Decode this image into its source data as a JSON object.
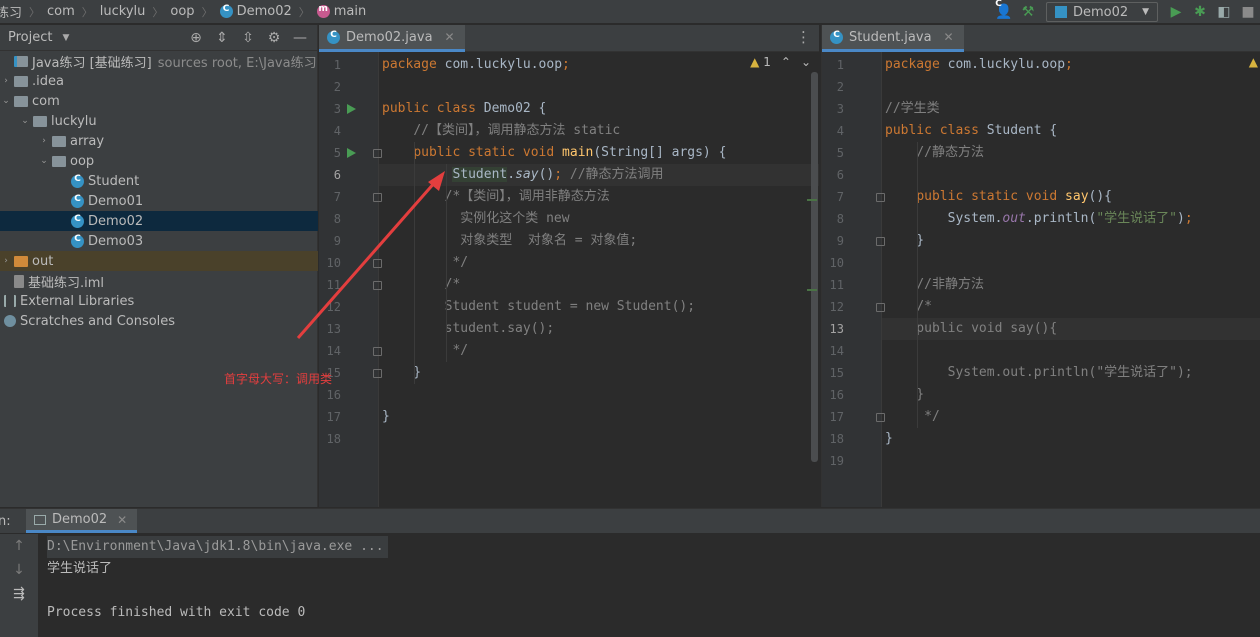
{
  "breadcrumbs": [
    "练习",
    "com",
    "luckylu",
    "oop",
    "Demo02",
    "main"
  ],
  "toolbar": {
    "run_config": "Demo02"
  },
  "project_panel": {
    "title": "Project",
    "tree": [
      {
        "label": "Java练习 [基础练习]",
        "hint": "sources root,  E:\\Java练习",
        "indent": 0,
        "arrow": "",
        "icon": "module"
      },
      {
        "label": ".idea",
        "indent": 0,
        "arrow": "›",
        "icon": "folder"
      },
      {
        "label": "com",
        "indent": 0,
        "arrow": "⌄",
        "icon": "pkg"
      },
      {
        "label": "luckylu",
        "indent": 1,
        "arrow": "⌄",
        "icon": "pkg"
      },
      {
        "label": "array",
        "indent": 2,
        "arrow": "›",
        "icon": "pkg"
      },
      {
        "label": "oop",
        "indent": 2,
        "arrow": "⌄",
        "icon": "pkg"
      },
      {
        "label": "Student",
        "indent": 3,
        "arrow": "",
        "icon": "class"
      },
      {
        "label": "Demo01",
        "indent": 3,
        "arrow": "",
        "icon": "class"
      },
      {
        "label": "Demo02",
        "indent": 3,
        "arrow": "",
        "icon": "class",
        "selected": true
      },
      {
        "label": "Demo03",
        "indent": 3,
        "arrow": "",
        "icon": "class"
      },
      {
        "label": "out",
        "indent": 0,
        "arrow": "›",
        "icon": "out",
        "excluded": true
      },
      {
        "label": "基础练习.iml",
        "indent": 0,
        "arrow": "",
        "icon": "iml"
      },
      {
        "label": "External Libraries",
        "indent": -1,
        "arrow": "",
        "icon": "lib"
      },
      {
        "label": "Scratches and Consoles",
        "indent": -1,
        "arrow": "",
        "icon": "scratch"
      }
    ]
  },
  "editor_left": {
    "tab": "Demo02.java",
    "inspection_count": "1",
    "current_line": 6,
    "line_count": 18,
    "lines": [
      "package com.luckylu.oop;",
      "",
      "public class Demo02 {",
      "    //【类间】，调用静态方法 static",
      "    public static void main(String[] args) {",
      "         Student.say(); //静态方法调用",
      "        /*【类间】，调用非静态方法",
      "          实例化这个类 new",
      "          对象类型  对象名 = 对象值;",
      "         */",
      "        /*",
      "        Student student = new Student();",
      "        student.say();",
      "         */",
      "    }",
      "",
      "}",
      ""
    ]
  },
  "editor_right": {
    "tab": "Student.java",
    "current_line": 13,
    "line_count": 19,
    "lines": [
      "package com.luckylu.oop;",
      "",
      "//学生类",
      "public class Student {",
      "    //静态方法",
      "",
      "    public static void say(){",
      "        System.out.println(\"学生说话了\");",
      "    }",
      "",
      "    //非静方法",
      "    /*",
      "    public void say(){",
      "",
      "        System.out.println(\"学生说话了\");",
      "    }",
      "     */",
      "}",
      ""
    ]
  },
  "annotation": {
    "label": "首字母大写：调用类"
  },
  "run_panel": {
    "prefix": "n:",
    "tab": "Demo02",
    "console": [
      "D:\\Environment\\Java\\jdk1.8\\bin\\java.exe ...",
      "学生说话了",
      "",
      "Process finished with exit code 0"
    ]
  },
  "icons": {
    "nav": [
      "user-icon",
      "build-hammer-icon",
      "run-icon",
      "debug-icon",
      "coverage-icon"
    ],
    "project_tools": [
      "locate-icon",
      "expand-all-icon",
      "collapse-all-icon",
      "settings-icon",
      "hide-icon"
    ],
    "run_side": [
      "scroll-up-icon",
      "scroll-down-icon",
      "soft-wrap-icon"
    ]
  },
  "colors": {
    "accent": "#4a88c7",
    "selection": "#0d293e",
    "keyword": "#cc7832",
    "annotation": "#e33e3e"
  }
}
